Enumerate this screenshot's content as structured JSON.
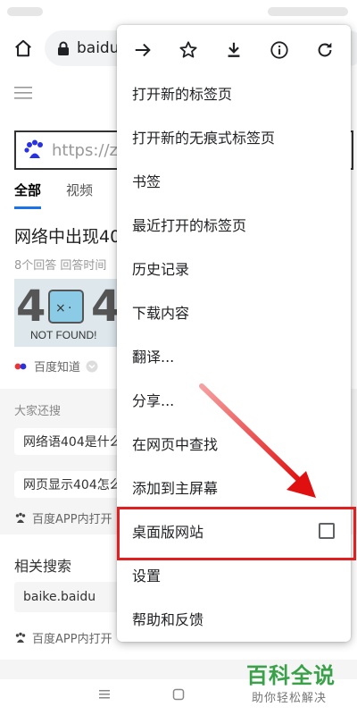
{
  "browser": {
    "url_text": "baidu"
  },
  "page": {
    "search_query": "https://zh",
    "tabs": [
      {
        "label": "全部"
      },
      {
        "label": "视频"
      }
    ],
    "result": {
      "title": "网络中出现40",
      "meta": "8个回答   回答时间",
      "thumb_digit_left": "4",
      "thumb_digit_right": "4",
      "thumb_caption": "NOT FOUND!",
      "source": "百度知道"
    },
    "also_search": {
      "title": "大家还搜",
      "chips": [
        "网络语404是什么",
        "网页显示404怎么"
      ],
      "app_line": "百度APP内打开"
    },
    "related": {
      "title": "相关搜索",
      "chip": "baike.baidu",
      "app_line": "百度APP内打开"
    }
  },
  "menu": {
    "icons": [
      "forward-icon",
      "bookmark-star-icon",
      "download-icon",
      "info-icon",
      "reload-icon"
    ],
    "items": [
      {
        "label": "打开新的标签页"
      },
      {
        "label": "打开新的无痕式标签页"
      },
      {
        "label": "书签"
      },
      {
        "label": "最近打开的标签页"
      },
      {
        "label": "历史记录"
      },
      {
        "label": "下载内容"
      },
      {
        "label": "翻译..."
      },
      {
        "label": "分享..."
      },
      {
        "label": "在网页中查找"
      },
      {
        "label": "添加到主屏幕"
      },
      {
        "label": "桌面版网站",
        "checkbox": false
      },
      {
        "label": "设置"
      },
      {
        "label": "帮助和反馈"
      }
    ]
  },
  "watermark": {
    "main": "百科全说",
    "sub": "助你轻松解决"
  },
  "colors": {
    "highlight": "#e02020",
    "watermark": "#3aa14a",
    "tab_underline": "#1a73e8"
  }
}
